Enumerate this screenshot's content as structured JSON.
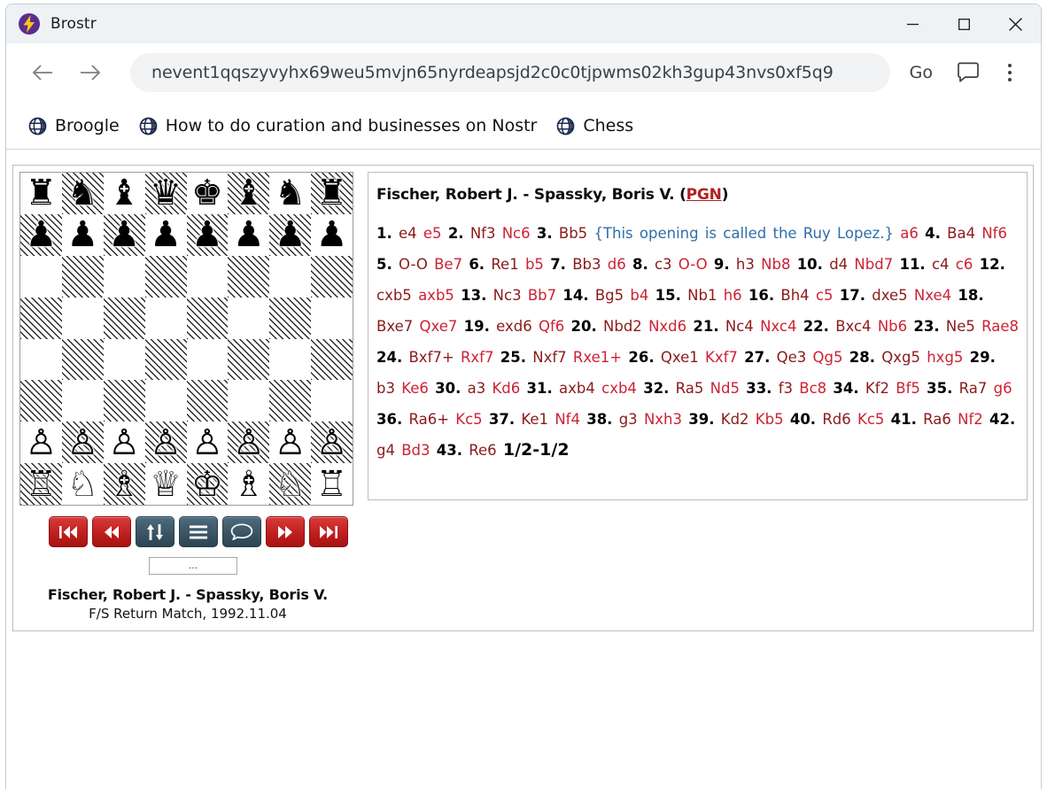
{
  "window": {
    "title": "Brostr",
    "app_icon": "lightning-bolt-icon",
    "minimize": "minimize-icon",
    "maximize": "maximize-icon",
    "close": "close-icon"
  },
  "toolbar": {
    "back": "back-arrow-icon",
    "forward": "forward-arrow-icon",
    "url_value": "nevent1qqszyvyhx69weu5mvjn65nyrdeapsjd2c0c0tjpwms02kh3gup43nvs0xf5q9",
    "url_placeholder": "Enter address",
    "go_label": "Go",
    "chat_icon": "chat-bubble-icon",
    "menu_icon": "kebab-menu-icon"
  },
  "bookmarks": [
    {
      "label": "Broogle",
      "icon": "globe-icon"
    },
    {
      "label": "How to do curation and businesses on Nostr",
      "icon": "globe-icon"
    },
    {
      "label": "Chess",
      "icon": "globe-icon"
    }
  ],
  "board": {
    "orientation": "white-bottom",
    "position_fen": "rnbqkbnr/pppppppp/8/8/8/8/PPPPPPPP/RNBQKBNR",
    "ranks": [
      [
        "r",
        "n",
        "b",
        "q",
        "k",
        "b",
        "n",
        "r"
      ],
      [
        "p",
        "p",
        "p",
        "p",
        "p",
        "p",
        "p",
        "p"
      ],
      [
        "",
        "",
        "",
        "",
        "",
        "",
        "",
        ""
      ],
      [
        "",
        "",
        "",
        "",
        "",
        "",
        "",
        ""
      ],
      [
        "",
        "",
        "",
        "",
        "",
        "",
        "",
        ""
      ],
      [
        "",
        "",
        "",
        "",
        "",
        "",
        "",
        ""
      ],
      [
        "P",
        "P",
        "P",
        "P",
        "P",
        "P",
        "P",
        "P"
      ],
      [
        "R",
        "N",
        "B",
        "Q",
        "K",
        "B",
        "N",
        "R"
      ]
    ],
    "glyphs": {
      "r": "♜",
      "n": "♞",
      "b": "♝",
      "q": "♛",
      "k": "♚",
      "p": "♟",
      "R": "♖",
      "N": "♘",
      "B": "♗",
      "Q": "♕",
      "K": "♔",
      "P": "♙"
    }
  },
  "controls": [
    {
      "name": "first-move-button",
      "label": "|<<",
      "color": "red",
      "icon": "skip-to-start-icon"
    },
    {
      "name": "previous-move-button",
      "label": "<<",
      "color": "red",
      "icon": "rewind-icon"
    },
    {
      "name": "flip-board-button",
      "label": "↑↓",
      "color": "blue",
      "icon": "flip-board-icon"
    },
    {
      "name": "moves-list-button",
      "label": "≡",
      "color": "blue",
      "icon": "hamburger-icon"
    },
    {
      "name": "comment-button",
      "label": "◯",
      "color": "blue",
      "icon": "speech-bubble-icon"
    },
    {
      "name": "next-move-button",
      "label": ">>",
      "color": "red",
      "icon": "fast-forward-icon"
    },
    {
      "name": "last-move-button",
      "label": ">>|",
      "color": "red",
      "icon": "skip-to-end-icon"
    }
  ],
  "move_input": {
    "value": "...",
    "placeholder": "..."
  },
  "caption": {
    "players": "Fischer, Robert J. - Spassky, Boris V.",
    "event": "F/S Return Match, 1992.11.04"
  },
  "pgn": {
    "title_players": "Fischer, Robert J. - Spassky, Boris V. (",
    "link_label": "PGN",
    "title_close": ")",
    "result": "1/2-1/2",
    "comment": "{This opening is called the Ruy Lopez.}",
    "moves": [
      {
        "no": "1.",
        "white": "e4",
        "black": "e5"
      },
      {
        "no": "2.",
        "white": "Nf3",
        "black": "Nc6"
      },
      {
        "no": "3.",
        "white": "Bb5",
        "comment": "{This opening is called the Ruy Lopez.}",
        "black": "a6"
      },
      {
        "no": "4.",
        "white": "Ba4",
        "black": "Nf6"
      },
      {
        "no": "5.",
        "white": "O-O",
        "black": "Be7"
      },
      {
        "no": "6.",
        "white": "Re1",
        "black": "b5"
      },
      {
        "no": "7.",
        "white": "Bb3",
        "black": "d6"
      },
      {
        "no": "8.",
        "white": "c3",
        "black": "O-O"
      },
      {
        "no": "9.",
        "white": "h3",
        "black": "Nb8"
      },
      {
        "no": "10.",
        "white": "d4",
        "black": "Nbd7"
      },
      {
        "no": "11.",
        "white": "c4",
        "black": "c6"
      },
      {
        "no": "12.",
        "white": "cxb5",
        "black": "axb5"
      },
      {
        "no": "13.",
        "white": "Nc3",
        "black": "Bb7"
      },
      {
        "no": "14.",
        "white": "Bg5",
        "black": "b4"
      },
      {
        "no": "15.",
        "white": "Nb1",
        "black": "h6"
      },
      {
        "no": "16.",
        "white": "Bh4",
        "black": "c5"
      },
      {
        "no": "17.",
        "white": "dxe5",
        "black": "Nxe4"
      },
      {
        "no": "18.",
        "white": "Bxe7",
        "black": "Qxe7"
      },
      {
        "no": "19.",
        "white": "exd6",
        "black": "Qf6"
      },
      {
        "no": "20.",
        "white": "Nbd2",
        "black": "Nxd6"
      },
      {
        "no": "21.",
        "white": "Nc4",
        "black": "Nxc4"
      },
      {
        "no": "22.",
        "white": "Bxc4",
        "black": "Nb6"
      },
      {
        "no": "23.",
        "white": "Ne5",
        "black": "Rae8"
      },
      {
        "no": "24.",
        "white": "Bxf7+",
        "black": "Rxf7"
      },
      {
        "no": "25.",
        "white": "Nxf7",
        "black": "Rxe1+"
      },
      {
        "no": "26.",
        "white": "Qxe1",
        "black": "Kxf7"
      },
      {
        "no": "27.",
        "white": "Qe3",
        "black": "Qg5"
      },
      {
        "no": "28.",
        "white": "Qxg5",
        "black": "hxg5"
      },
      {
        "no": "29.",
        "white": "b3",
        "black": "Ke6"
      },
      {
        "no": "30.",
        "white": "a3",
        "black": "Kd6"
      },
      {
        "no": "31.",
        "white": "axb4",
        "black": "cxb4"
      },
      {
        "no": "32.",
        "white": "Ra5",
        "black": "Nd5"
      },
      {
        "no": "33.",
        "white": "f3",
        "black": "Bc8"
      },
      {
        "no": "34.",
        "white": "Kf2",
        "black": "Bf5"
      },
      {
        "no": "35.",
        "white": "Ra7",
        "black": "g6"
      },
      {
        "no": "36.",
        "white": "Ra6+",
        "black": "Kc5"
      },
      {
        "no": "37.",
        "white": "Ke1",
        "black": "Nf4"
      },
      {
        "no": "38.",
        "white": "g3",
        "black": "Nxh3"
      },
      {
        "no": "39.",
        "white": "Kd2",
        "black": "Kb5"
      },
      {
        "no": "40.",
        "white": "Rd6",
        "black": "Kc5"
      },
      {
        "no": "41.",
        "white": "Ra6",
        "black": "Nf2"
      },
      {
        "no": "42.",
        "white": "g4",
        "black": "Bd3"
      },
      {
        "no": "43.",
        "white": "Re6",
        "black": ""
      }
    ]
  },
  "colors": {
    "accent_red": "#bf1f1f",
    "accent_blue": "#3a5565",
    "white_move": "#8b1a1a",
    "black_move": "#cc2233",
    "comment": "#2e6fa8",
    "link": "#b41f1f",
    "titlebar_bg": "#eef2f5",
    "urlbar_bg": "#f1f3f4"
  }
}
